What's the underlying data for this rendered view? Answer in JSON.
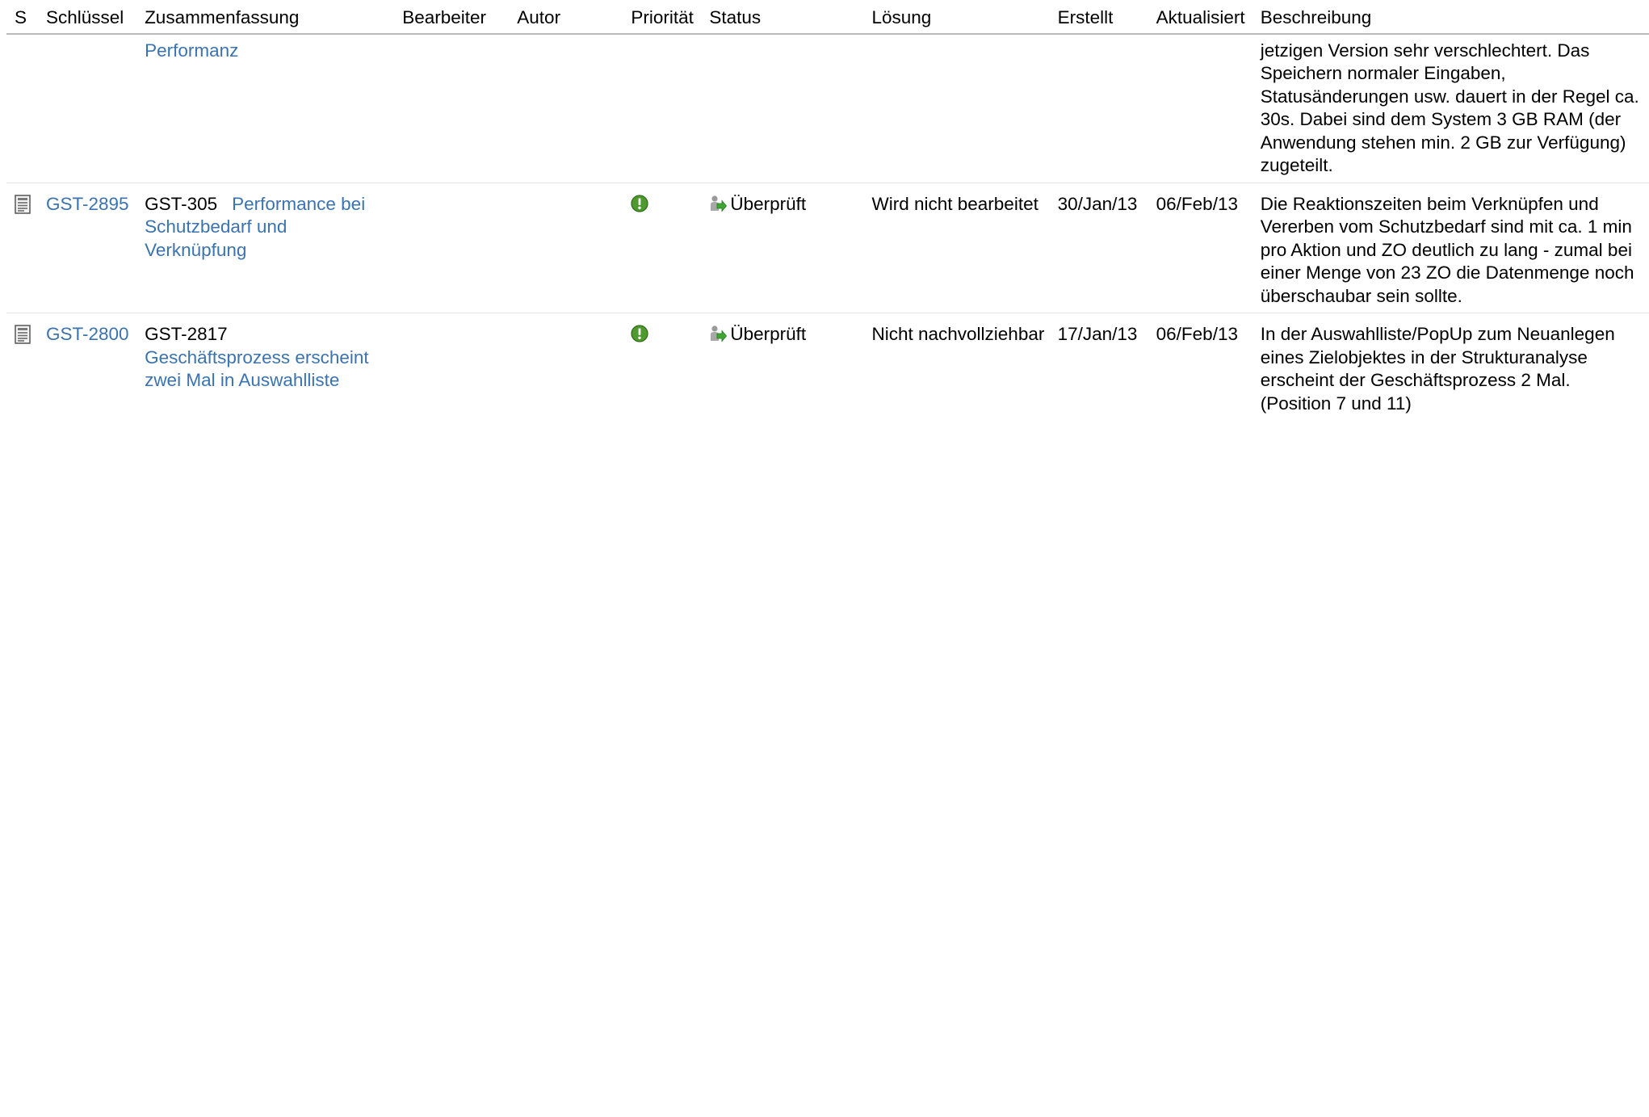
{
  "columns": {
    "s": "S",
    "key": "Schlüssel",
    "summary": "Zusammenfassung",
    "assignee": "Bearbeiter",
    "reporter": "Autor",
    "priority": "Priorität",
    "status": "Status",
    "resolution": "Lösung",
    "created": "Erstellt",
    "updated": "Aktualisiert",
    "description": "Beschreibung"
  },
  "rows": [
    {
      "summary_link": "Performanz",
      "description": "jetzigen Version sehr verschlechtert. Das Speichern normaler Eingaben, Statusänderungen usw. dauert in der Regel ca. 30s. Dabei sind dem System 3 GB RAM (der Anwendung stehen min. 2 GB zur Verfügung) zugeteilt."
    },
    {
      "type_icon": "document-icon",
      "key": "GST-2895",
      "parent_key": "GST-305",
      "summary_link": "Performance bei Schutzbedarf und Verknüpfung",
      "assignee": "",
      "reporter": "",
      "priority_icon": "priority-exclamation-icon",
      "status_icon": "status-reviewed-icon",
      "status": "Überprüft",
      "resolution": "Wird nicht bearbeitet",
      "created": "30/Jan/13",
      "updated": "06/Feb/13",
      "description": "Die Reaktionszeiten beim Verknüpfen und Vererben vom Schutzbedarf sind mit ca. 1 min pro Aktion und ZO deutlich zu lang - zumal bei einer Menge von 23 ZO die Datenmenge noch überschaubar sein sollte."
    },
    {
      "type_icon": "document-icon",
      "key": "GST-2800",
      "parent_key": "GST-2817",
      "summary_link": "Geschäftsprozess erscheint zwei Mal in Auswahlliste",
      "assignee": "",
      "reporter": "",
      "priority_icon": "priority-exclamation-icon",
      "status_icon": "status-reviewed-icon",
      "status": "Überprüft",
      "resolution": "Nicht nachvollziehbar",
      "created": "17/Jan/13",
      "updated": "06/Feb/13",
      "description": "In der Auswahlliste/PopUp zum Neuanlegen eines Zielobjektes in der Strukturanalyse erscheint der Geschäftsprozess 2 Mal. (Position 7 und 11)"
    }
  ]
}
